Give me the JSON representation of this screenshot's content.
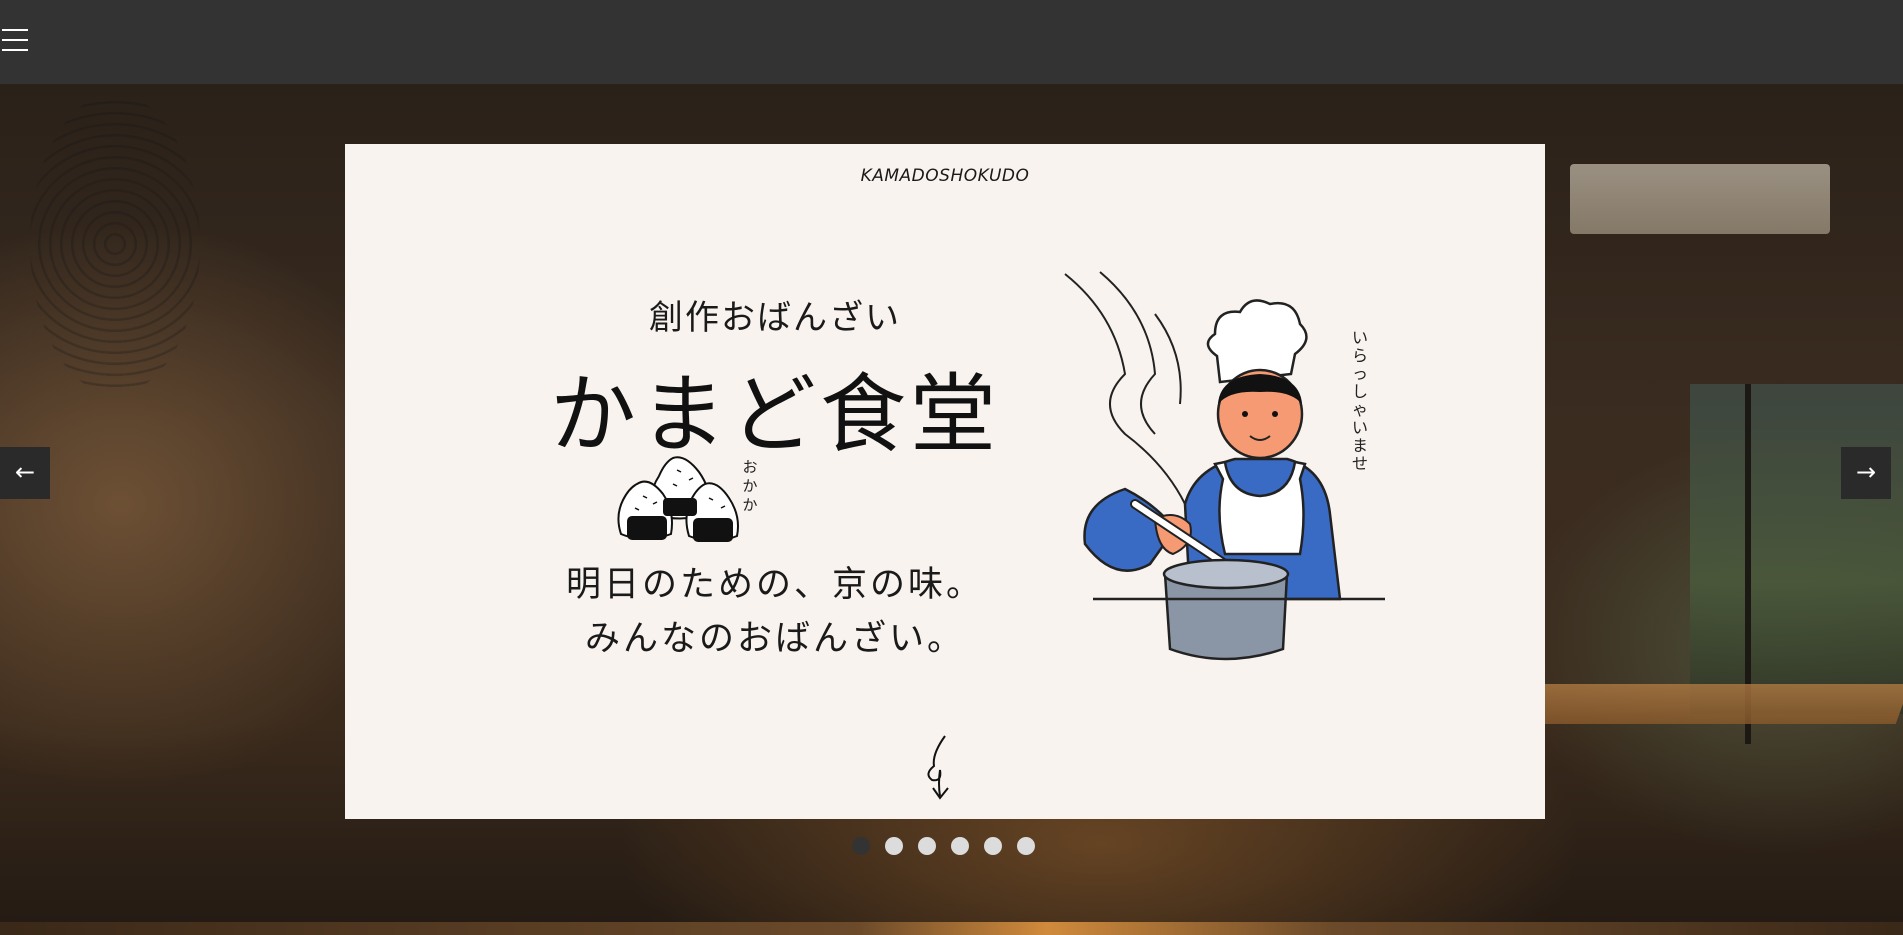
{
  "header": {
    "menu_icon": "hamburger-icon"
  },
  "slider": {
    "prev_label": "←",
    "next_label": "→",
    "dot_count": 6,
    "active_index": 0
  },
  "slide": {
    "brand": "KAMADOSHOKUDO",
    "subtitle": "創作おばんざい",
    "title": "かまど食堂",
    "okaka_label": "おかか",
    "tagline_line1": "明日のための、京の味。",
    "tagline_line2": "みんなのおばんざい。",
    "chef_speech": "いらっしゃいませ"
  },
  "colors": {
    "topbar": "#333333",
    "card_bg": "#f8f3ef",
    "chef_shirt": "#3a6bc4",
    "chef_skin": "#f59a72",
    "pot": "#8a95a5"
  }
}
